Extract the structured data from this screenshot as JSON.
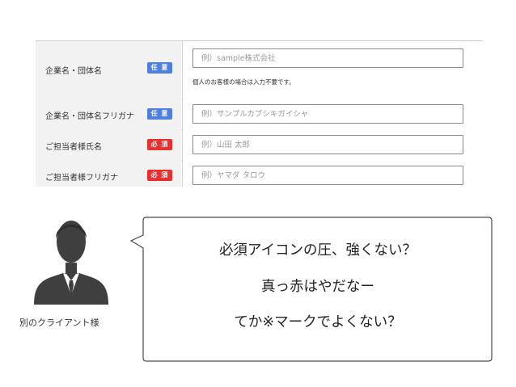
{
  "form": {
    "rows": [
      {
        "label": "企業名・団体名",
        "badge": "任 意",
        "badge_type": "optional",
        "placeholder": "例）sample株式会社",
        "hint": "個人のお客様の場合は入力不要です。"
      },
      {
        "label": "企業名・団体名フリガナ",
        "badge": "任 意",
        "badge_type": "optional",
        "placeholder": "例）サンプルカブシキガイシャ"
      },
      {
        "label": "ご担当者様氏名",
        "badge": "必 須",
        "badge_type": "required",
        "placeholder": "例）山田 太郎"
      },
      {
        "label": "ご担当者様フリガナ",
        "badge": "必 須",
        "badge_type": "required",
        "placeholder": "例）ヤマダ タロウ"
      }
    ],
    "colors": {
      "optional": "#4f7fe0",
      "required": "#e83030"
    }
  },
  "person": {
    "icon": "businessman-icon",
    "caption": "別のクライアント様"
  },
  "speech": {
    "lines": [
      "必須アイコンの圧、強くない？",
      "真っ赤はやだなー",
      "てか※マークでよくない？"
    ]
  }
}
